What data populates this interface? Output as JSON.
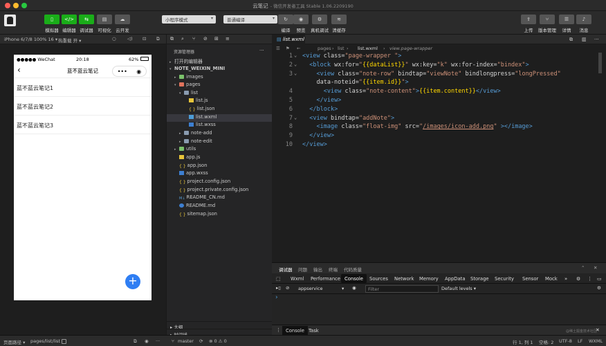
{
  "window": {
    "title": "云笔记",
    "subtitle": "- 微信开发者工具 Stable 1.06.2209190"
  },
  "toolbar": {
    "left_buttons": [
      {
        "label": "模拟器",
        "icon": "phone-icon"
      },
      {
        "label": "编辑器",
        "icon": "code-icon"
      },
      {
        "label": "调试器",
        "icon": "debug-icon"
      },
      {
        "label": "可视化",
        "icon": "visual-icon"
      },
      {
        "label": "云开发",
        "icon": "cloud-icon"
      }
    ],
    "mode_select": "小程序模式",
    "compile_select": "普通编译",
    "mid_buttons": [
      {
        "label": "编译",
        "icon": "refresh-icon"
      },
      {
        "label": "预览",
        "icon": "eye-icon"
      },
      {
        "label": "真机调试",
        "icon": "gear-icon"
      },
      {
        "label": "清缓存",
        "icon": "layers-icon"
      }
    ],
    "right_buttons": [
      {
        "label": "上传",
        "icon": "upload-icon"
      },
      {
        "label": "版本管理",
        "icon": "branch-icon"
      },
      {
        "label": "详情",
        "icon": "menu-icon"
      },
      {
        "label": "消息",
        "icon": "bell-icon"
      }
    ]
  },
  "simulator": {
    "device": "iPhone 6/7/8 100% 16 ▾",
    "hotreload": "热重载 开 ▾",
    "status_carrier": "●●●●● WeChat",
    "status_time": "20:18",
    "status_battery": "62%",
    "page_title": "蓝不蓝云笔记",
    "notes": [
      "蓝不蓝云笔记1",
      "蓝不蓝云笔记2",
      "蓝不蓝云笔记3"
    ],
    "fab": "+"
  },
  "explorer": {
    "header": "资源管理器",
    "more": "···",
    "open_editors": "打开的编辑器",
    "project": "NOTE_WEIXIN_MINI",
    "tree": [
      {
        "label": "images",
        "kind": "folder-green",
        "depth": 1,
        "caret": "▸"
      },
      {
        "label": "pages",
        "kind": "folder-red",
        "depth": 1,
        "caret": "▾"
      },
      {
        "label": "list",
        "kind": "folder",
        "depth": 2,
        "caret": "▾"
      },
      {
        "label": "list.js",
        "kind": "js",
        "depth": 3,
        "caret": ""
      },
      {
        "label": "list.json",
        "kind": "json",
        "depth": 3,
        "caret": ""
      },
      {
        "label": "list.wxml",
        "kind": "wxml",
        "depth": 3,
        "caret": "",
        "selected": true
      },
      {
        "label": "list.wxss",
        "kind": "wxss",
        "depth": 3,
        "caret": ""
      },
      {
        "label": "note-add",
        "kind": "folder",
        "depth": 2,
        "caret": "▸"
      },
      {
        "label": "note-edit",
        "kind": "folder",
        "depth": 2,
        "caret": "▸"
      },
      {
        "label": "utils",
        "kind": "folder-green",
        "depth": 1,
        "caret": "▸"
      },
      {
        "label": "app.js",
        "kind": "js",
        "depth": 1,
        "caret": ""
      },
      {
        "label": "app.json",
        "kind": "json",
        "depth": 1,
        "caret": ""
      },
      {
        "label": "app.wxss",
        "kind": "wxss",
        "depth": 1,
        "caret": ""
      },
      {
        "label": "project.config.json",
        "kind": "json",
        "depth": 1,
        "caret": ""
      },
      {
        "label": "project.private.config.json",
        "kind": "json",
        "depth": 1,
        "caret": ""
      },
      {
        "label": "README_CN.md",
        "kind": "md",
        "depth": 1,
        "caret": ""
      },
      {
        "label": "README.md",
        "kind": "info",
        "depth": 1,
        "caret": ""
      },
      {
        "label": "sitemap.json",
        "kind": "json",
        "depth": 1,
        "caret": ""
      }
    ],
    "outline": "大纲",
    "timeline": "时间线"
  },
  "editor": {
    "tab": "list.wxml",
    "breadcrumb": [
      "pages",
      "list",
      "list.wxml",
      "view.page-wrapper"
    ],
    "lines": [
      "<view class=\"page-wrapper \">",
      "  <block wx:for=\"{{dataList}}\" wx:key=\"k\" wx:for-index=\"bindex\">",
      "    <view class=\"note-row\" bindtap=\"viewNote\" bindlongpress=\"longPressed\"",
      "    data-noteid=\"{{item.id}}\">",
      "      <view class=\"note-content\">{{item.content}}</view>",
      "    </view>",
      "  </block>",
      "  <view bindtap=\"addNote\">",
      "    <image class=\"float-img\" src=\"/images/icon-add.png\" ></image>",
      "  </view>",
      "</view>"
    ],
    "line_numbers": [
      "1",
      "2",
      "3",
      "",
      "4",
      "5",
      "6",
      "7",
      "8",
      "9",
      "10"
    ]
  },
  "debugger": {
    "tabs": [
      "调试器",
      "问题",
      "输出",
      "终端",
      "代码质量"
    ],
    "devtabs": [
      "Wxml",
      "Performance",
      "Console",
      "Sources",
      "Network",
      "Memory",
      "AppData",
      "Storage",
      "Security",
      "Sensor",
      "Mock",
      "»"
    ],
    "active_devtab": "Console",
    "context": "appservice",
    "filter_placeholder": "Filter",
    "levels": "Default levels ▾",
    "prompt": "›",
    "bottom_tabs": [
      "Console",
      "Task"
    ]
  },
  "statusbar": {
    "path_label": "页面路径 ▾",
    "path": "pages/list/list",
    "branch": "master",
    "errors": "⊗ 0 ⚠ 0",
    "cursor": "行 1, 列 1",
    "spaces": "空格: 2",
    "encoding": "UTF-8",
    "eol": "LF",
    "lang": "WXML",
    "watermark": "@稀土掘金技术社区"
  }
}
